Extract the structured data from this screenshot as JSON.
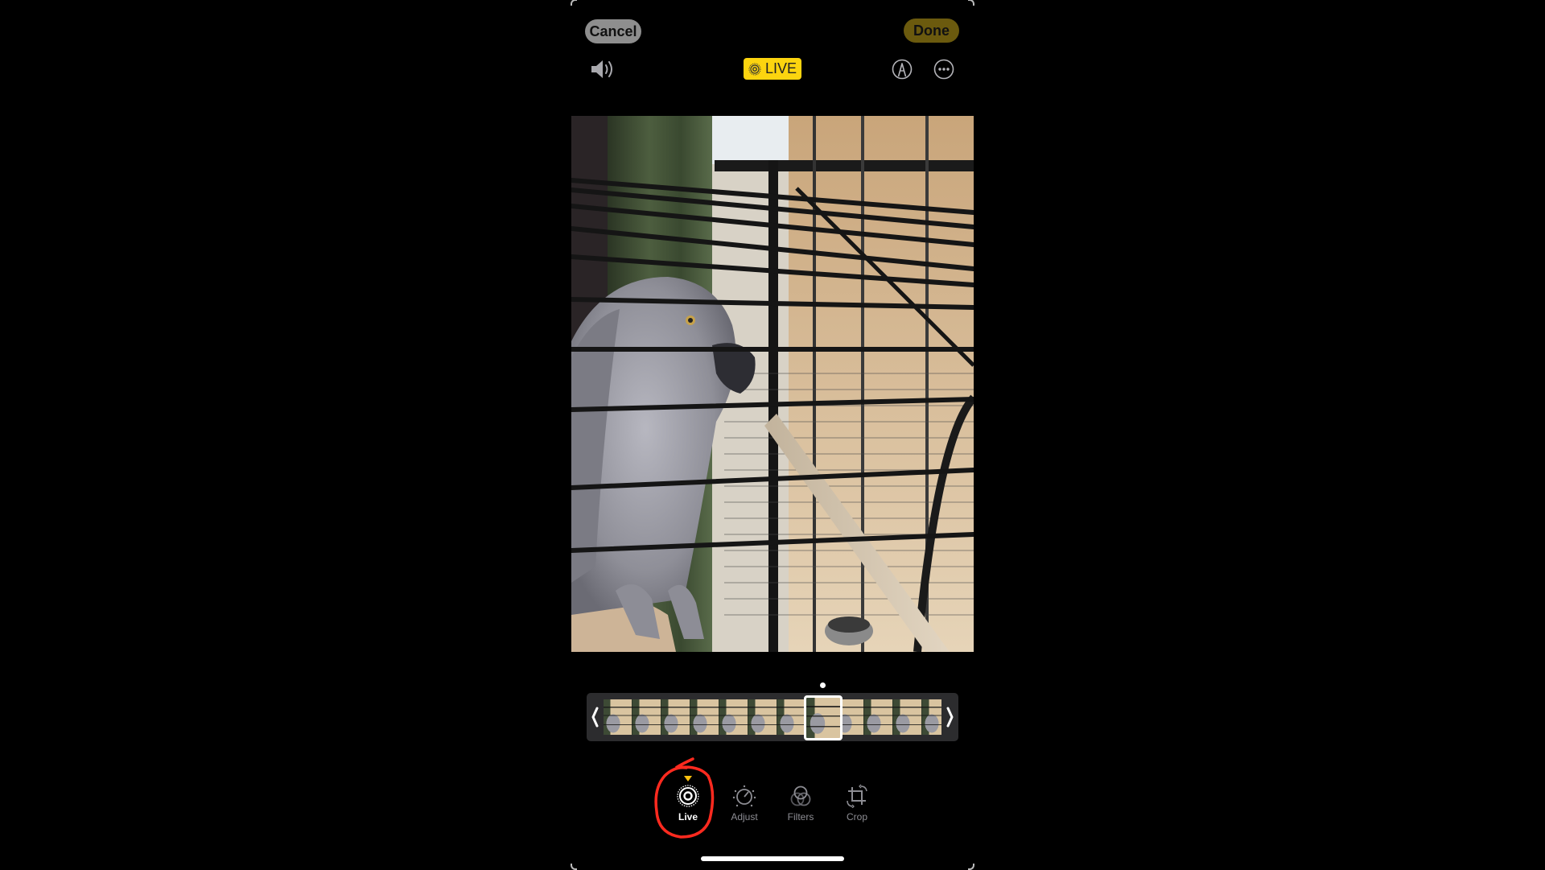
{
  "header": {
    "cancel_label": "Cancel",
    "done_label": "Done",
    "live_badge_label": "LIVE",
    "sound_icon": "speaker-wave-icon",
    "markup_icon": "markup-pen-icon",
    "more_icon": "ellipsis-circle-icon"
  },
  "photo": {
    "subject": "African grey parrot in a cage"
  },
  "live_editor": {
    "frame_count": 12,
    "selected_frame_index": 7,
    "trim_left_icon": "chevron-left-icon",
    "trim_right_icon": "chevron-right-icon"
  },
  "toolbar": {
    "tools": [
      {
        "label": "Live",
        "icon": "live-photo-icon",
        "active": true
      },
      {
        "label": "Adjust",
        "icon": "adjust-dial-icon",
        "active": false
      },
      {
        "label": "Filters",
        "icon": "filters-circles-icon",
        "active": false
      },
      {
        "label": "Crop",
        "icon": "crop-rotate-icon",
        "active": false
      }
    ]
  },
  "colors": {
    "accent_yellow": "#fcd40f",
    "done_button": "#6b5a0e",
    "cancel_button": "#8e8e8e",
    "annotation_red": "#ff2a1f",
    "filmstrip_bg": "#2c2c2e"
  }
}
